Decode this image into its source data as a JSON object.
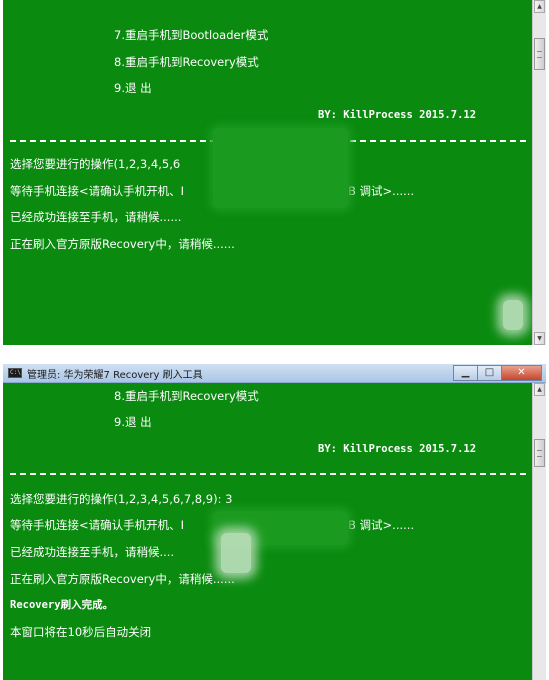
{
  "window1": {
    "lines": {
      "menu7": "7.重启手机到Bootloader模式",
      "menu8": "8.重启手机到Recovery模式",
      "menu9": "9.退 出",
      "byline": "BY: KillProcess 2015.7.12",
      "prompt": "选择您要进行的操作(1,2,3,4,5,6",
      "wait_a": "等待手机连接<请确认手机开机、I",
      "wait_b": "B 调试>......",
      "connected": "已经成功连接至手机，请稍候......",
      "flashing": "正在刷入官方原版Recovery中，请稍候......"
    }
  },
  "window2": {
    "title": "管理员: 华为荣耀7 Recovery 刷入工具",
    "controls": {
      "minimize": "▁",
      "maximize": "□",
      "close": "✕"
    },
    "lines": {
      "menu8": "8.重启手机到Recovery模式",
      "menu9": "9.退 出",
      "byline": "BY: KillProcess 2015.7.12",
      "prompt": "选择您要进行的操作(1,2,3,4,5,6,7,8,9): 3",
      "wait_a": "等待手机连接<请确认手机开机、I",
      "wait_b": "B 调试>......",
      "connected": "已经成功连接至手机，请稍候....",
      "flashing": "正在刷入官方原版Recovery中，请稍候......",
      "done": "Recovery刷入完成。",
      "autoclose": "本窗口将在10秒后自动关闭"
    }
  },
  "colors": {
    "console_bg": "#0a8a0f",
    "console_text": "#ffffff",
    "titlebar": "#aac6e6"
  }
}
